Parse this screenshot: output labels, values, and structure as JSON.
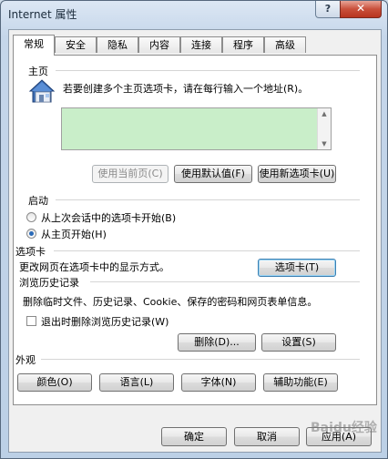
{
  "window": {
    "title": "Internet 属性",
    "help_label": "?",
    "close_label": "✕"
  },
  "tabs": [
    {
      "label": "常规",
      "active": true
    },
    {
      "label": "安全"
    },
    {
      "label": "隐私"
    },
    {
      "label": "内容"
    },
    {
      "label": "连接"
    },
    {
      "label": "程序"
    },
    {
      "label": "高级"
    }
  ],
  "homepage": {
    "section_label": "主页",
    "description": "若要创建多个主页选项卡，请在每行输入一个地址(R)。",
    "address_value": "",
    "use_current": "使用当前页(C)",
    "use_default": "使用默认值(F)",
    "use_new_tab": "使用新选项卡(U)"
  },
  "startup": {
    "section_label": "启动",
    "option_last_session": "从上次会话中的选项卡开始(B)",
    "option_home": "从主页开始(H)",
    "selected": "home"
  },
  "tabs_section": {
    "section_label": "选项卡",
    "description": "更改网页在选项卡中的显示方式。",
    "button": "选项卡(T)"
  },
  "history": {
    "section_label": "浏览历史记录",
    "description": "删除临时文件、历史记录、Cookie、保存的密码和网页表单信息。",
    "checkbox_label": "退出时删除浏览历史记录(W)",
    "delete_button": "删除(D)...",
    "settings_button": "设置(S)"
  },
  "appearance": {
    "section_label": "外观",
    "colors": "颜色(O)",
    "languages": "语言(L)",
    "fonts": "字体(N)",
    "accessibility": "辅助功能(E)"
  },
  "footer": {
    "ok": "确定",
    "cancel": "取消",
    "apply": "应用(A)"
  },
  "watermark": "Baidu经验",
  "colors": {
    "address_bg": "#c9eec9",
    "title_bar": "#c5d6ea"
  }
}
